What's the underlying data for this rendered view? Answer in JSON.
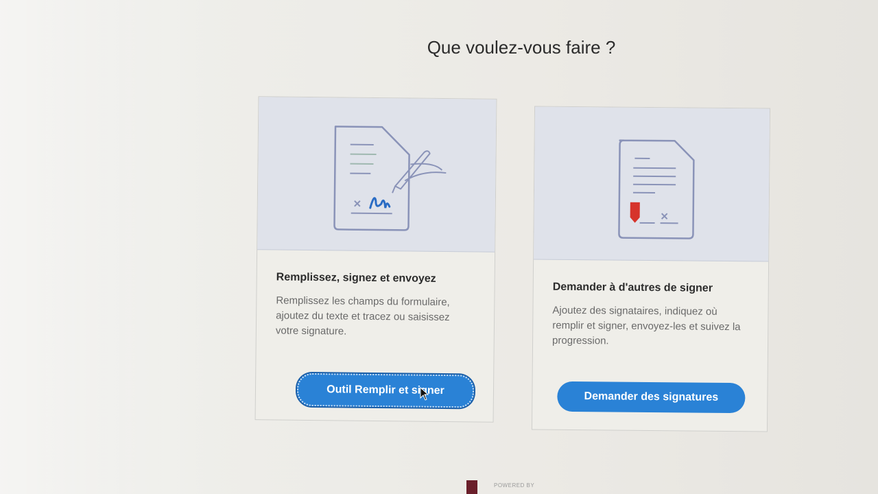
{
  "heading": "Que voulez-vous faire ?",
  "cards": [
    {
      "title": "Remplissez, signez et envoyez",
      "description": "Remplissez les champs du formulaire, ajoutez du texte et tracez ou saisissez votre signature.",
      "button_label": "Outil Remplir et signer",
      "icon": "fill-sign-document-icon"
    },
    {
      "title": "Demander à d'autres de signer",
      "description": "Ajoutez des signataires, indiquez où remplir et signer, envoyez-les et suivez la progression.",
      "button_label": "Demander des signatures",
      "icon": "request-signatures-document-icon"
    }
  ],
  "footer": {
    "powered_by": "POWERED BY"
  },
  "colors": {
    "accent": "#2a82d6",
    "illustration_bg": "#dfe2ea",
    "icon_stroke": "#8a93b8",
    "signature_blue": "#2a6cc4",
    "marker_red": "#d6332b"
  }
}
